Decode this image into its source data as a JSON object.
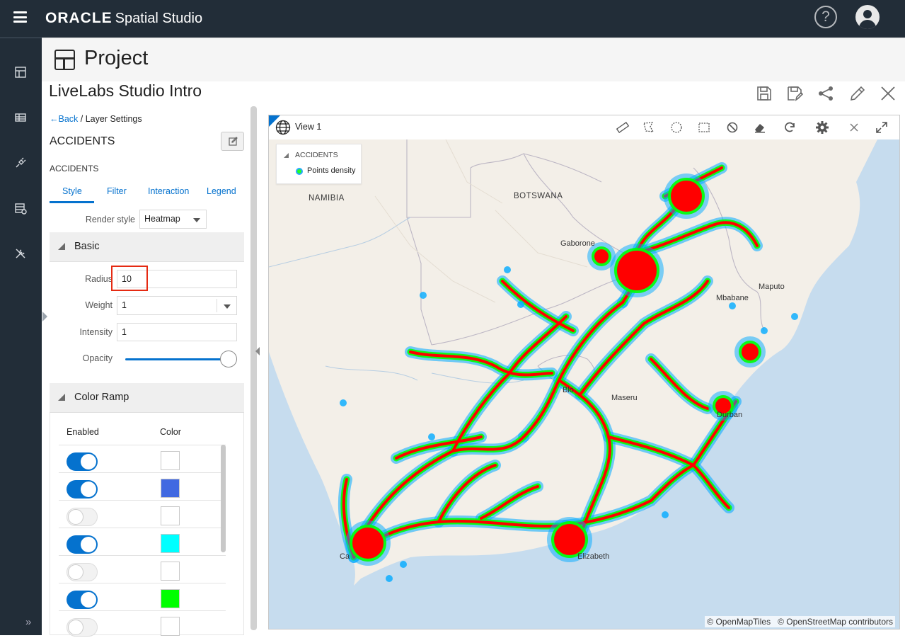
{
  "app": {
    "brand_oracle": "ORACLE",
    "brand_product": "Spatial Studio",
    "help_glyph": "?"
  },
  "project": {
    "header_title": "Project",
    "name": "LiveLabs Studio Intro"
  },
  "panel": {
    "back_label": "Back",
    "crumb_sep": " / ",
    "crumb_current": "Layer Settings",
    "layer_title": "ACCIDENTS",
    "layer_subtitle": "ACCIDENTS",
    "tabs": [
      "Style",
      "Filter",
      "Interaction",
      "Legend"
    ],
    "active_tab": "Style",
    "render_style_label": "Render style",
    "render_style_value": "Heatmap",
    "basic_section": "Basic",
    "radius_label": "Radius",
    "radius_value": "10",
    "weight_label": "Weight",
    "weight_value": "1",
    "intensity_label": "Intensity",
    "intensity_value": "1",
    "opacity_label": "Opacity",
    "opacity_value": 1.0,
    "color_ramp_section": "Color Ramp",
    "ramp_enabled_header": "Enabled",
    "ramp_color_header": "Color",
    "ramp_rows": [
      {
        "enabled": true,
        "color": "#ffffff"
      },
      {
        "enabled": true,
        "color": "#4169e1"
      },
      {
        "enabled": false,
        "color": "#ffffff"
      },
      {
        "enabled": true,
        "color": "#00ffff"
      },
      {
        "enabled": false,
        "color": "#ffffff"
      },
      {
        "enabled": true,
        "color": "#00ff00"
      },
      {
        "enabled": false,
        "color": "#ffffff"
      }
    ]
  },
  "map": {
    "view_title": "View 1",
    "legend_title": "ACCIDENTS",
    "legend_item": "Points density",
    "attribution_tiles": "© OpenMapTiles",
    "attribution_osm": "© OpenStreetMap contributors",
    "labels": {
      "namibia": "NAMIBIA",
      "botswana": "BOTSWANA",
      "gaborone": "Gaborone",
      "maputo": "Maputo",
      "mbabane": "Mbabane",
      "maseru": "Maseru",
      "durban": "Durban",
      "cape": "Ca",
      "elizabeth": "Elizabeth",
      "bloem": "Blo"
    }
  },
  "colors": {
    "accent": "#0572ce",
    "topbar": "#222d38",
    "highlight": "#e52a12",
    "heat_hot": "#ff0000",
    "heat_mid": "#00ff00",
    "heat_low": "#00aaff",
    "water": "#c6dcee",
    "land": "#f3efe8"
  }
}
